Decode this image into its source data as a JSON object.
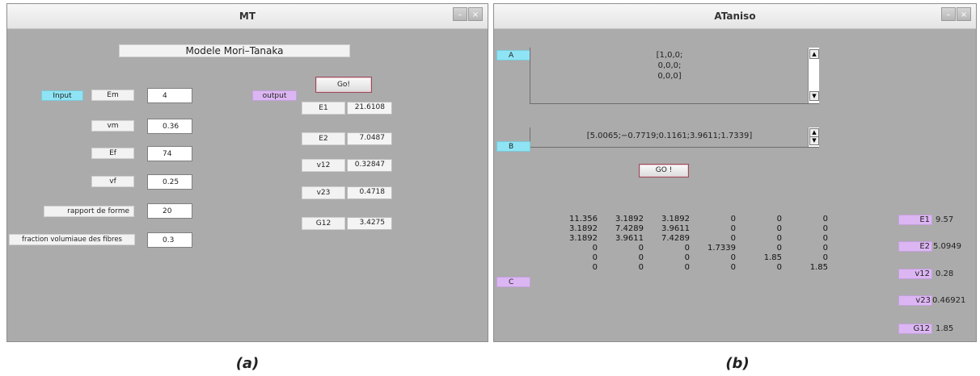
{
  "windows": {
    "mt": {
      "title": "MT",
      "heading": "Modele Mori–Tanaka",
      "input_tag": "Input",
      "output_tag": "output",
      "go_label": "Go!",
      "inputs": [
        {
          "label": "Em",
          "value": "4"
        },
        {
          "label": "vm",
          "value": "0.36"
        },
        {
          "label": "Ef",
          "value": "74"
        },
        {
          "label": "vf",
          "value": "0.25"
        },
        {
          "label": "rapport de forme",
          "value": "20"
        },
        {
          "label": "fraction volumiaue des fibres",
          "value": "0.3"
        }
      ],
      "outputs": [
        {
          "label": "E1",
          "value": "21.6108"
        },
        {
          "label": "E2",
          "value": "7.0487"
        },
        {
          "label": "v12",
          "value": "0.32847"
        },
        {
          "label": "v23",
          "value": "0.4718"
        },
        {
          "label": "G12",
          "value": "3.4275"
        }
      ]
    },
    "ataniso": {
      "title": "ATaniso",
      "tag_a": "A",
      "tag_b": "B",
      "tag_c": "C",
      "matrix_a": [
        "[1,0,0;",
        "0,0,0;",
        "0,0,0]"
      ],
      "vector_b": "[5.0065;−0.7719;0.1161;3.9611;1.7339]",
      "go_label": "GO !",
      "matrix_c": [
        [
          "11.356",
          "3.1892",
          "3.1892",
          "0",
          "0",
          "0"
        ],
        [
          "3.1892",
          "7.4289",
          "3.9611",
          "0",
          "0",
          "0"
        ],
        [
          "3.1892",
          "3.9611",
          "7.4289",
          "0",
          "0",
          "0"
        ],
        [
          "0",
          "0",
          "0",
          "1.7339",
          "0",
          "0"
        ],
        [
          "0",
          "0",
          "0",
          "0",
          "1.85",
          "0"
        ],
        [
          "0",
          "0",
          "0",
          "0",
          "0",
          "1.85"
        ]
      ],
      "results": [
        {
          "label": "E1",
          "value": "9.57"
        },
        {
          "label": "E2",
          "value": "5.0949"
        },
        {
          "label": "v12",
          "value": "0.28"
        },
        {
          "label": "v23",
          "value": "0.46921"
        },
        {
          "label": "G12",
          "value": "1.85"
        }
      ]
    }
  },
  "window_controls": {
    "minimize": "–",
    "close": "×"
  },
  "captions": {
    "a": "(a)",
    "b": "(b)"
  }
}
